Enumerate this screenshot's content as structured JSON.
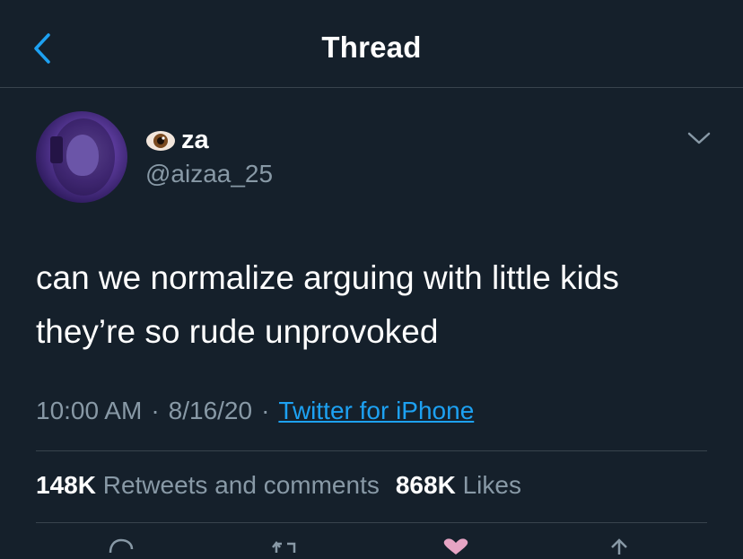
{
  "header": {
    "title": "Thread"
  },
  "tweet": {
    "author": {
      "name": "za",
      "name_emoji": "eye",
      "handle": "@aizaa_25"
    },
    "text_lines": [
      "can we normalize arguing with little kids",
      "they’re so rude unprovoked"
    ],
    "time": "10:00 AM",
    "date": "8/16/20",
    "separator": "·",
    "source": "Twitter for iPhone",
    "stats": {
      "retweets_count": "148K",
      "retweets_label": "Retweets and comments",
      "likes_count": "868K",
      "likes_label": "Likes"
    }
  },
  "colors": {
    "background": "#15202b",
    "text": "#ffffff",
    "secondary_text": "#8899a6",
    "accent": "#1da1f2",
    "divider": "#38444d",
    "like": "#e0245e"
  },
  "icons": {
    "back": "chevron-left-icon",
    "more": "chevron-down-icon",
    "reply": "reply-icon",
    "retweet": "retweet-icon",
    "like": "heart-icon",
    "share": "share-icon"
  }
}
